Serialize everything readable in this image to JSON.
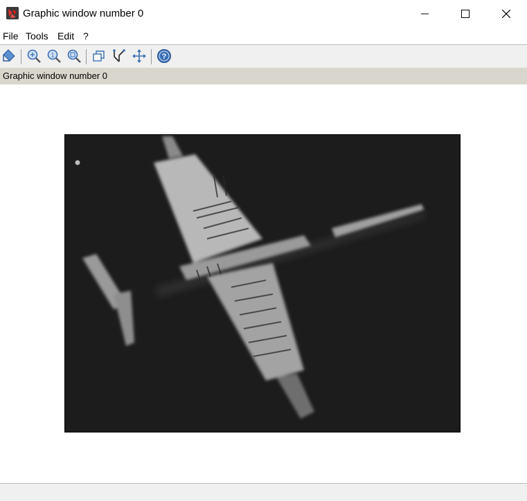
{
  "window": {
    "title": "Graphic window number 0"
  },
  "menu": {
    "items": [
      "File",
      "Tools",
      "Edit",
      "?"
    ]
  },
  "toolbar": {
    "buttons": [
      "datatip-icon",
      "zoom-in-icon",
      "zoom-original-icon",
      "zoom-area-icon",
      "rotate-icon",
      "data-bounds-icon",
      "pan-icon",
      "help-icon"
    ]
  },
  "infobar": {
    "text": "Graphic window number 0"
  },
  "colors": {
    "infobar": "#d9d6ce",
    "toolbar": "#f0f0f0",
    "icon_blue": "#3b6fb6",
    "image_bg": "#1b1b1b"
  }
}
